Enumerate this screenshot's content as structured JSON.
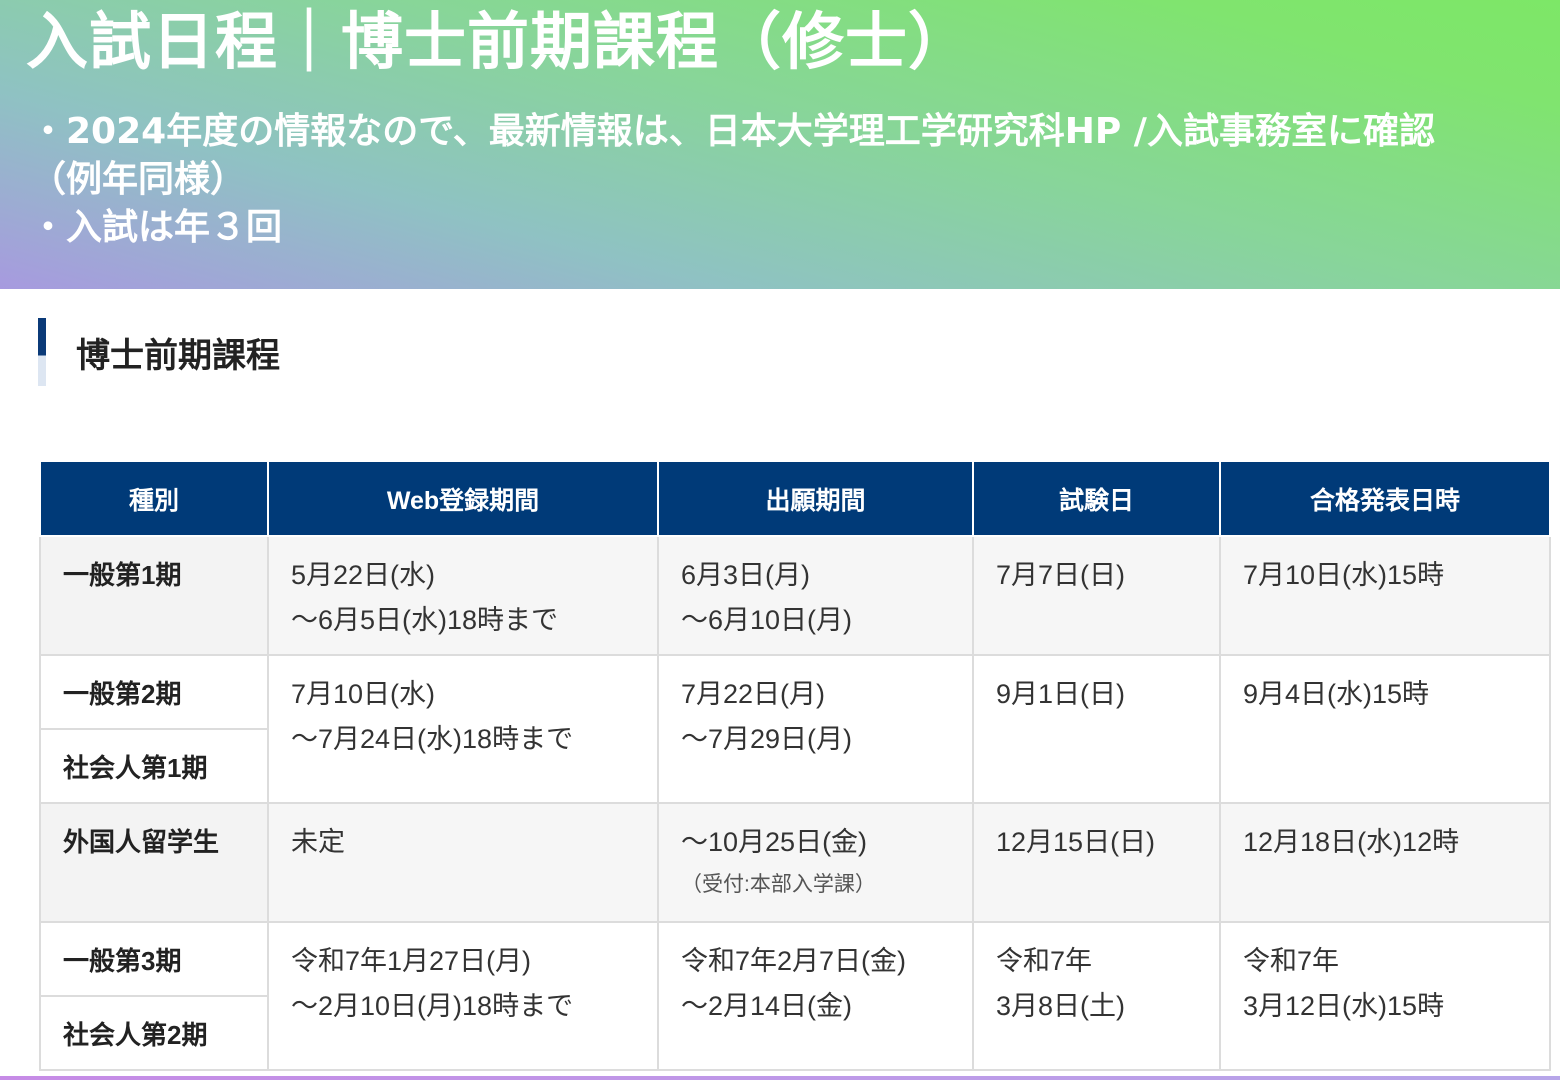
{
  "banner": {
    "title": "入試日程｜博士前期課程（修士）",
    "notes": [
      "・2024年度の情報なので、最新情報は、日本大学理工学研究科HP /入試事務室に確認",
      "（例年同様）",
      "・入試は年３回"
    ]
  },
  "section": {
    "heading": "博士前期課程"
  },
  "table": {
    "headers": [
      "種別",
      "Web登録期間",
      "出願期間",
      "試験日",
      "合格発表日時"
    ],
    "rows": [
      {
        "kinds": [
          "一般第1期"
        ],
        "web": [
          "5月22日(水)",
          "～6月5日(水)18時まで"
        ],
        "apply": [
          "6月3日(月)",
          "～6月10日(月)"
        ],
        "apply_note": "",
        "exam": [
          "7月7日(日)"
        ],
        "result": [
          "7月10日(水)15時"
        ]
      },
      {
        "kinds": [
          "一般第2期",
          "社会人第1期"
        ],
        "web": [
          "7月10日(水)",
          "～7月24日(水)18時まで"
        ],
        "apply": [
          "7月22日(月)",
          "～7月29日(月)"
        ],
        "apply_note": "",
        "exam": [
          "9月1日(日)"
        ],
        "result": [
          "9月4日(水)15時"
        ]
      },
      {
        "kinds": [
          "外国人留学生"
        ],
        "web": [
          "未定"
        ],
        "apply": [
          "～10月25日(金)"
        ],
        "apply_note": "（受付:本部入学課）",
        "exam": [
          "12月15日(日)"
        ],
        "result": [
          "12月18日(水)12時"
        ]
      },
      {
        "kinds": [
          "一般第3期",
          "社会人第2期"
        ],
        "web": [
          "令和7年1月27日(月)",
          "～2月10日(月)18時まで"
        ],
        "apply": [
          "令和7年2月7日(金)",
          "～2月14日(金)"
        ],
        "apply_note": "",
        "exam": [
          "令和7年",
          "3月8日(土)"
        ],
        "result": [
          "令和7年",
          "3月12日(水)15時"
        ]
      }
    ]
  },
  "colors": {
    "header_bg": "#003a78",
    "accent_bar": "#0b3a78"
  }
}
